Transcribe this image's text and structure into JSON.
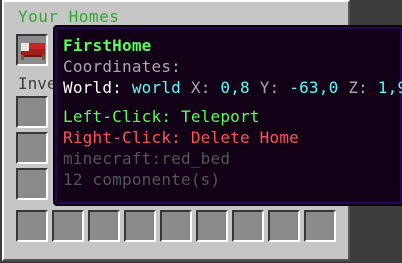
{
  "window": {
    "title": "Your Homes",
    "inventory_label": "Inve"
  },
  "slots": {
    "home_item_icon": "red-bed-icon"
  },
  "tooltip": {
    "name": "FirstHome",
    "coordinates_label": "Coordinates:",
    "world_label": "World:",
    "world_value": "world",
    "x_label": "X:",
    "x_value": "0,8",
    "y_label": "Y:",
    "y_value": "-63,0",
    "z_label": "Z:",
    "z_value": "1,9",
    "left_click": "Left-Click: Teleport",
    "right_click": "Right-Click: Delete Home",
    "item_id": "minecraft:red_bed",
    "components": "12 componente(s)"
  },
  "colors": {
    "title": "#2fa82f",
    "name": "#55ff55",
    "label_gray": "#aaaaaa",
    "value_aqua": "#55ffff",
    "action_green": "#55ff55",
    "action_red": "#ff5555",
    "meta_dark": "#555555",
    "tooltip_bg": "#120116",
    "tooltip_border": "#2a0555"
  }
}
